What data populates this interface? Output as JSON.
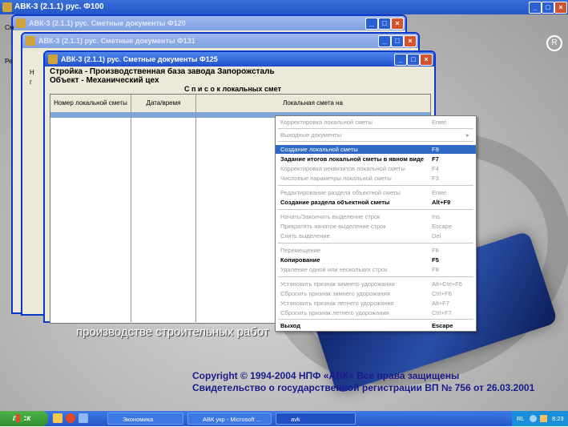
{
  "desktop": {
    "bg_text_line": "производстве строительных работ",
    "copyright_1": "Copyright © 1994-2004 НПФ «АВК»   Все права защищены",
    "copyright_2": "Свидетельство о государственной регистрации ВП № 756 от 26.03.2001"
  },
  "main_title": "АВК-3 (2.1.1)  рус.         Ф100",
  "windows": [
    {
      "title": "АВК-3 (2.1.1)  рус.  Сметные документы          Ф120",
      "side": "См"
    },
    {
      "title": "АВК-3 (2.1.1)  рус.  Сметные документы          Ф131",
      "side": "Ре"
    },
    {
      "title": "АВК-3 (2.1.1)  рус.  Сметные документы          Ф125"
    }
  ],
  "side_letters": [
    "Н",
    "г"
  ],
  "header": {
    "line1": "Стройка - Производственная база завода Запорожсталь",
    "line2": "Объект - Механический цех",
    "list_title": "С п и с о к   локальных смет"
  },
  "grid": {
    "columns": [
      "Номер локальной сметы",
      "Дата/время",
      "Локальная смета на"
    ]
  },
  "menu": {
    "items": [
      {
        "label": "Корректировка локальной сметы",
        "key": "Enter",
        "state": "dis"
      },
      {
        "label": "Выходные документы",
        "key": "▸",
        "state": "dis"
      },
      {
        "label": "Создание локальной сметы",
        "key": "F9",
        "state": "hl"
      },
      {
        "label": "Задание итогов локальной сметы в явном виде",
        "key": "F7",
        "state": "bold"
      },
      {
        "label": "Корректировка реквизитов локальной сметы",
        "key": "F4",
        "state": "dis"
      },
      {
        "label": "Числовые параметры локальной сметы",
        "key": "F3",
        "state": "dis"
      },
      {
        "label": "Редактирование раздела объектной сметы",
        "key": "Enter",
        "state": "dis"
      },
      {
        "label": "Создание раздела объектной сметы",
        "key": "Alt+F9",
        "state": "bold"
      },
      {
        "label": "Начать/Закончить выделение строк",
        "key": "Ins",
        "state": "dis"
      },
      {
        "label": "Прекратить начатое выделение строк",
        "key": "Escape",
        "state": "dis"
      },
      {
        "label": "Снять выделение",
        "key": "Del",
        "state": "dis"
      },
      {
        "label": "Перемещение",
        "key": "F6",
        "state": "dis"
      },
      {
        "label": "Копирование",
        "key": "F5",
        "state": "bold"
      },
      {
        "label": "Удаление одной или нескольких строк",
        "key": "F8",
        "state": "dis"
      },
      {
        "label": "Установить признак зимнего удорожания",
        "key": "Alt+Ctrl+F6",
        "state": "dis"
      },
      {
        "label": "Сбросить признак зимнего удорожания",
        "key": "Ctrl+F6",
        "state": "dis"
      },
      {
        "label": "Установить признак летнего удорожания",
        "key": "Alt+F7",
        "state": "dis"
      },
      {
        "label": "Сбросить признак летнего удорожания",
        "key": "Ctrl+F7",
        "state": "dis"
      },
      {
        "label": "Выход",
        "key": "Escape",
        "state": "bold"
      }
    ]
  },
  "taskbar": {
    "start": "пуск",
    "buttons": [
      "Экономика",
      "АВК укр - Microsoft ...",
      "avk"
    ],
    "tray_lang": "RL",
    "clock": "8:23"
  }
}
